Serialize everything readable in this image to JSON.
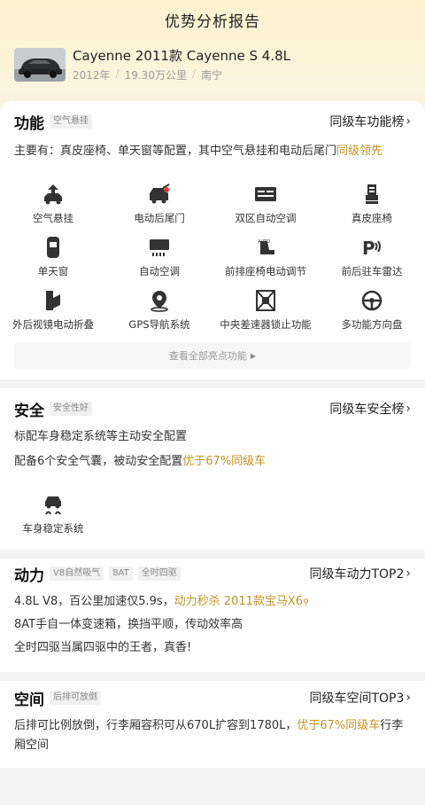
{
  "header": {
    "title": "优势分析报告"
  },
  "car": {
    "name": "Cayenne 2011款 Cayenne S 4.8L",
    "year": "2012年",
    "mileage": "19.30万公里",
    "city": "南宁",
    "sep": "/"
  },
  "features_section": {
    "title": "功能",
    "tag": "空气悬挂",
    "link": "同级车功能榜",
    "summary_prefix": "主要有：真皮座椅、单天窗等配置，其中空气悬挂和电动后尾门",
    "summary_highlight": "同级领先",
    "items": [
      {
        "label": "空气悬挂",
        "icon": "air-suspension-icon"
      },
      {
        "label": "电动后尾门",
        "icon": "power-tailgate-icon"
      },
      {
        "label": "双区自动空调",
        "icon": "dual-zone-ac-icon"
      },
      {
        "label": "真皮座椅",
        "icon": "leather-seat-icon"
      },
      {
        "label": "单天窗",
        "icon": "sunroof-icon"
      },
      {
        "label": "自动空调",
        "icon": "auto-ac-icon"
      },
      {
        "label": "前排座椅电动调节",
        "icon": "power-seat-icon"
      },
      {
        "label": "前后驻车雷达",
        "icon": "parking-radar-icon"
      },
      {
        "label": "外后视镜电动折叠",
        "icon": "mirror-fold-icon"
      },
      {
        "label": "GPS导航系统",
        "icon": "gps-icon"
      },
      {
        "label": "中央差速器锁止功能",
        "icon": "diff-lock-icon"
      },
      {
        "label": "多功能方向盘",
        "icon": "steering-wheel-icon"
      }
    ],
    "view_all": "查看全部亮点功能"
  },
  "safety_section": {
    "title": "安全",
    "tag": "安全性好",
    "link": "同级车安全榜",
    "line1": "标配车身稳定系统等主动安全配置",
    "line2_prefix": "配备6个安全气囊，被动安全配置",
    "line2_highlight": "优于67%同级车",
    "items": [
      {
        "label": "车身稳定系统",
        "icon": "stability-control-icon"
      }
    ]
  },
  "power_section": {
    "title": "动力",
    "tags": [
      "V8自然吸气",
      "8AT",
      "全时四驱"
    ],
    "link": "同级车动力TOP2",
    "line1_prefix": "4.8L V8，百公里加速仅5.9s，",
    "line1_highlight": "动力秒杀 2011款宝马X6",
    "line2": "8AT手自一体变速箱，换挡平顺，传动效率高",
    "line3": "全时四驱当属四驱中的王者，真香!"
  },
  "space_section": {
    "title": "空间",
    "tag": "后排可放倒",
    "link": "同级车空间TOP3",
    "line_prefix": "后排可比例放倒，行李厢容积可从670L扩容到1780L，",
    "line_highlight": "优于67%同级车",
    "line_suffix": "行李厢空间"
  },
  "colors": {
    "highlight": "#c49323",
    "accent_bg": "#fdf1cf"
  }
}
